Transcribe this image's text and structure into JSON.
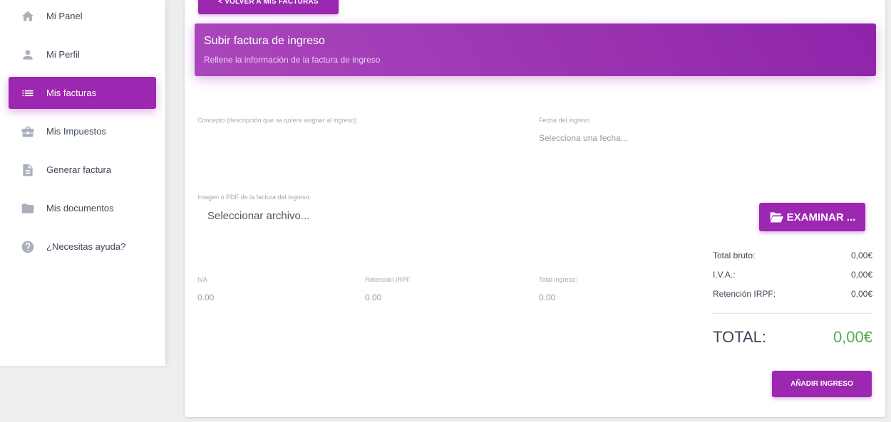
{
  "sidebar": {
    "items": [
      {
        "label": "Mi Panel",
        "icon": "home-icon"
      },
      {
        "label": "Mi Perfil",
        "icon": "person-icon"
      },
      {
        "label": "Mis facturas",
        "icon": "list-icon",
        "active": true
      },
      {
        "label": "Mis Impuestos",
        "icon": "briefcase-icon"
      },
      {
        "label": "Generar factura",
        "icon": "document-icon"
      },
      {
        "label": "Mis documentos",
        "icon": "folder-icon"
      },
      {
        "label": "¿Necesitas ayuda?",
        "icon": "help-icon"
      }
    ]
  },
  "toolbar": {
    "back_label": "< VOLVER A MIS FACTURAS"
  },
  "header": {
    "title": "Subir factura de ingreso",
    "subtitle": "Rellene la información de la factura de ingreso"
  },
  "form": {
    "concept_label": "Concepto (descripción que se quiere asignar al ingreso)",
    "date_label": "Fecha del ingreso",
    "date_placeholder": "Selecciona una fecha...",
    "file_label": "Imagen ó PDF de la factura del ingreso:",
    "file_placeholder": "Seleccionar archivo...",
    "browse_label": "EXAMINAR ...",
    "iva_label": "IVA",
    "iva_value": "0.00",
    "irpf_label": "Retención IRPF",
    "irpf_value": "0.00",
    "total_income_label": "Total ingreso:",
    "total_income_value": "0.00"
  },
  "summary": {
    "gross_label": "Total bruto:",
    "gross_value": "0,00€",
    "iva_label": "I.V.A.:",
    "iva_value": "0,00€",
    "irpf_label": "Retención IRPF:",
    "irpf_value": "0,00€",
    "total_label": "TOTAL:",
    "total_value": "0,00€"
  },
  "actions": {
    "add_label": "AÑADIR INGRESO"
  },
  "colors": {
    "accent": "#9c27b0",
    "total_green": "#4caf50"
  }
}
